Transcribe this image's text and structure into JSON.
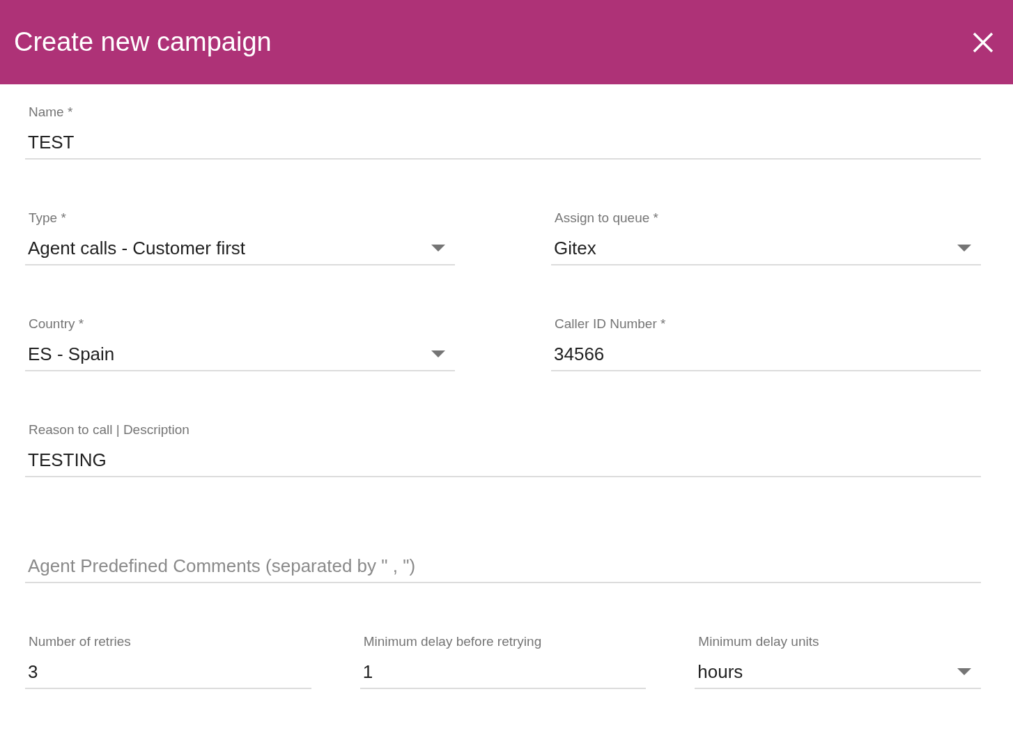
{
  "header": {
    "title": "Create new campaign"
  },
  "rows": [
    {
      "fields": [
        {
          "kind": "text",
          "label": "Name *",
          "value": "TEST"
        }
      ]
    },
    {
      "fields": [
        {
          "kind": "select",
          "label": "Type *",
          "value": "Agent calls - Customer first"
        },
        {
          "kind": "select",
          "label": "Assign to queue *",
          "value": "Gitex"
        }
      ]
    },
    {
      "fields": [
        {
          "kind": "select",
          "label": "Country *",
          "value": "ES - Spain"
        },
        {
          "kind": "text",
          "label": "Caller ID Number *",
          "value": "34566"
        }
      ]
    },
    {
      "fields": [
        {
          "kind": "text",
          "label": "Reason to call | Description",
          "value": "TESTING"
        }
      ]
    },
    {
      "fields": [
        {
          "kind": "text",
          "placeholder": "Agent Predefined Comments (separated by \" , \")"
        }
      ]
    },
    {
      "fields": [
        {
          "kind": "text",
          "label": "Number of retries",
          "value": "3"
        },
        {
          "kind": "text",
          "label": "Minimum delay before retrying",
          "value": "1"
        },
        {
          "kind": "select",
          "label": "Minimum delay units",
          "value": "hours"
        }
      ]
    }
  ]
}
